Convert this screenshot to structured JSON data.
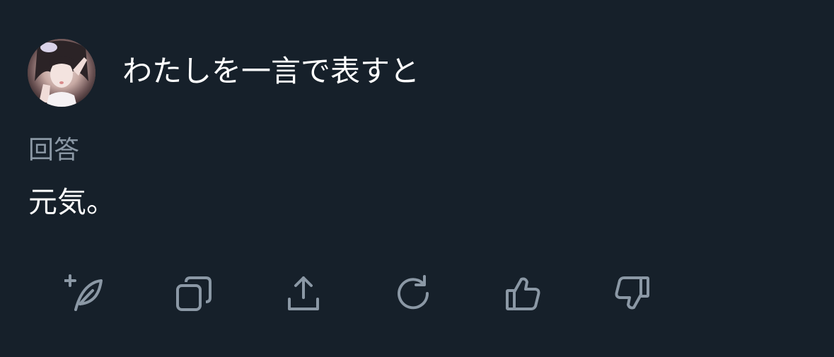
{
  "prompt": {
    "title": "わたしを一言で表すと"
  },
  "answer": {
    "label": "回答",
    "text": "元気。"
  },
  "actions": [
    {
      "icon": "quill-plus-icon"
    },
    {
      "icon": "copy-icon"
    },
    {
      "icon": "share-icon"
    },
    {
      "icon": "regenerate-icon"
    },
    {
      "icon": "thumbs-up-icon"
    },
    {
      "icon": "thumbs-down-icon"
    }
  ],
  "colors": {
    "background": "#16202a",
    "text": "#ffffff",
    "muted": "#8b98a5",
    "icon": "#8b98a5"
  }
}
